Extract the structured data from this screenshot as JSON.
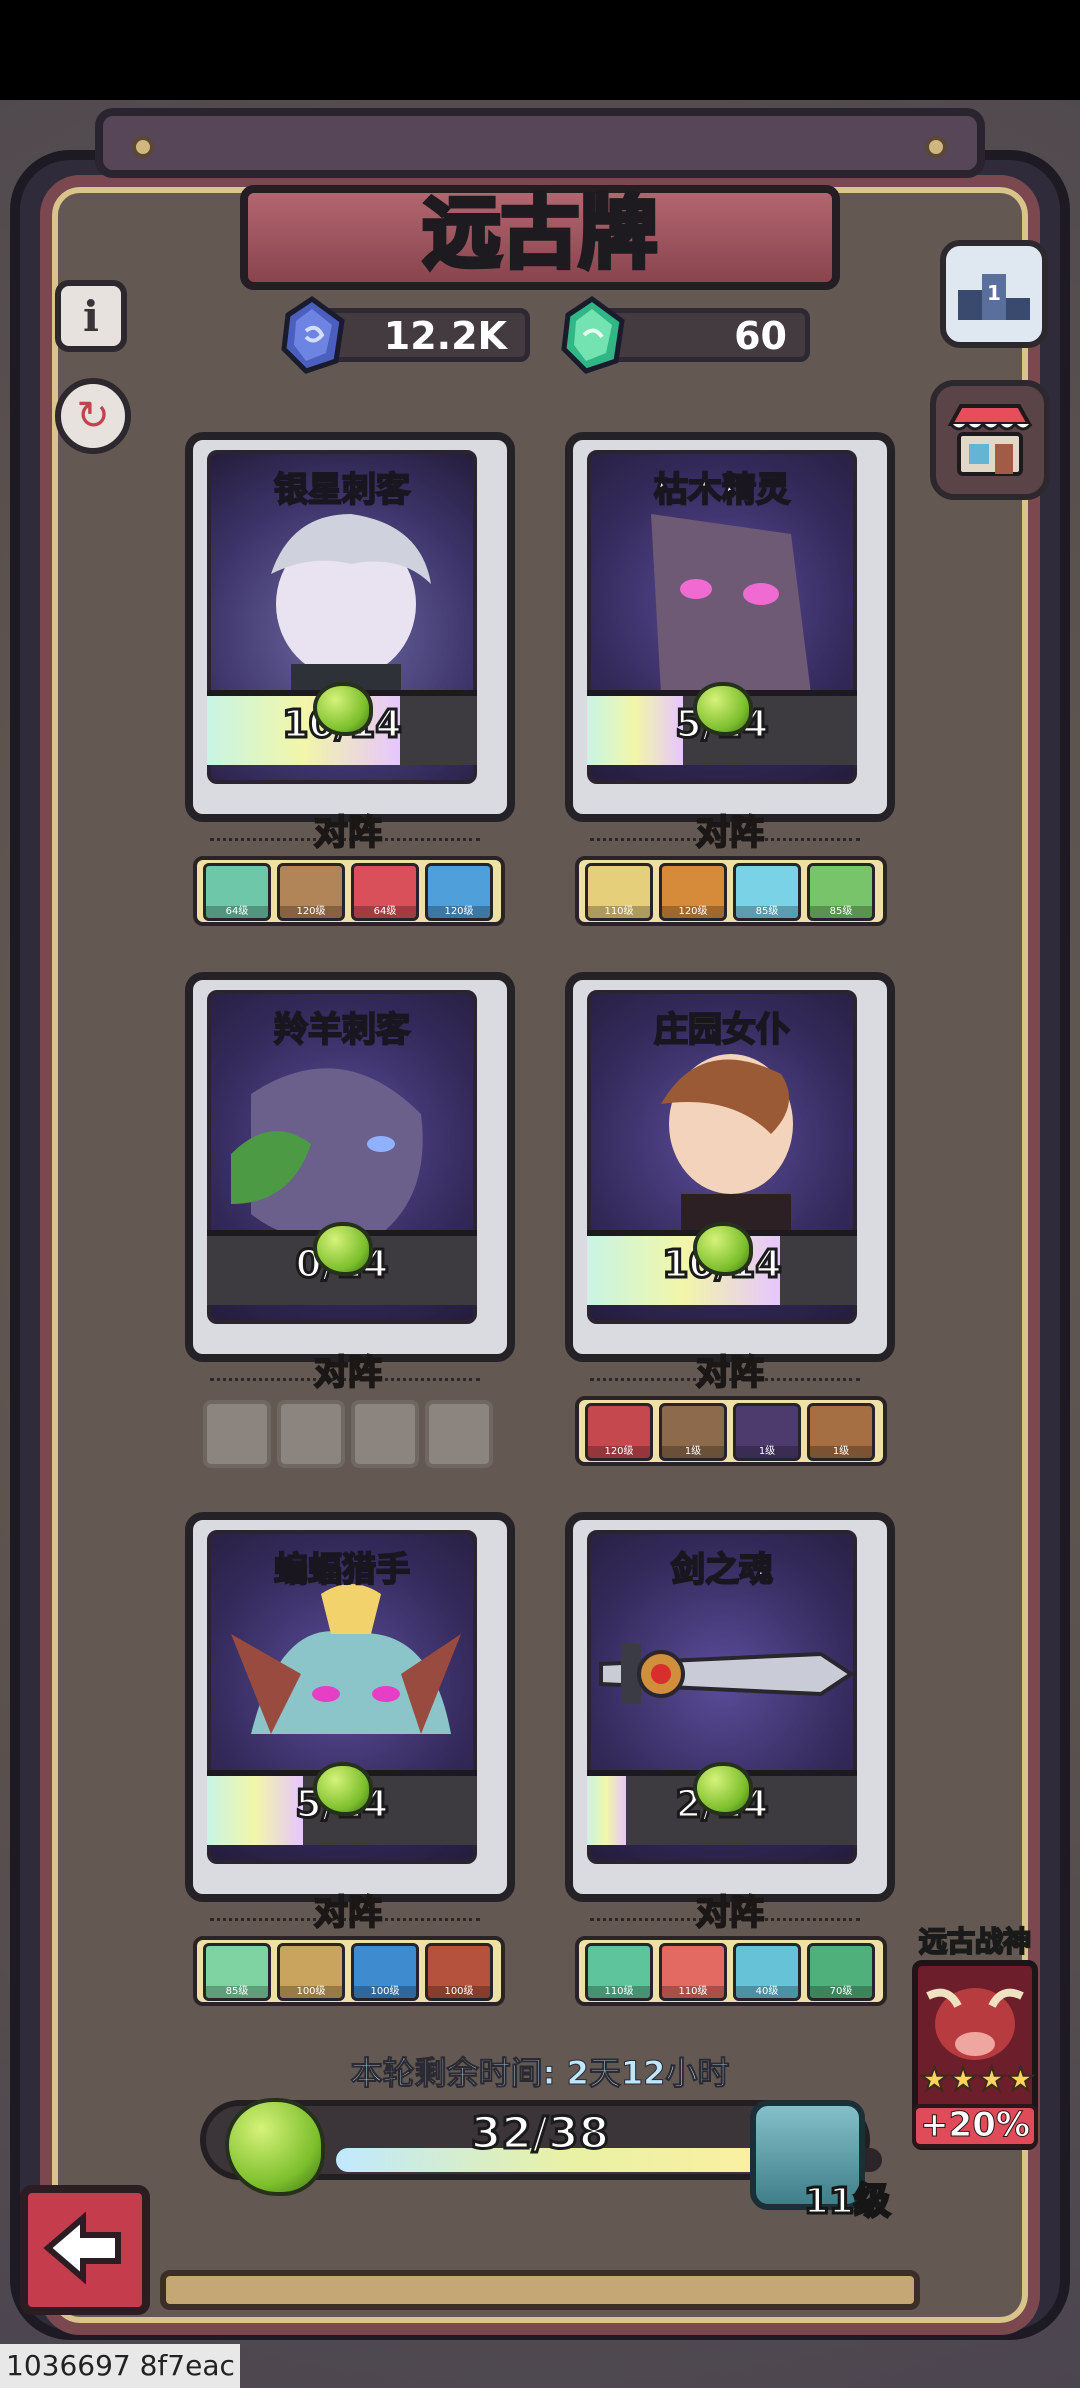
{
  "header": {
    "title": "远古牌",
    "currency_blue": "12.2K",
    "currency_green": "60"
  },
  "side_buttons": {
    "left_top": "info-icon",
    "left_second": "refresh-icon",
    "right_top": "ranking-icon",
    "right_second": "shop-icon"
  },
  "cards": [
    {
      "name": "银星刺客",
      "progress": "10/14",
      "fraction": 0.714,
      "team_label": "对阵",
      "team": [
        "64级",
        "120级",
        "64级",
        "120级"
      ]
    },
    {
      "name": "枯木精灵",
      "progress": "5/14",
      "fraction": 0.357,
      "team_label": "对阵",
      "team": [
        "110级",
        "120级",
        "85级",
        "85级"
      ]
    },
    {
      "name": "羚羊刺客",
      "progress": "0/14",
      "fraction": 0.0,
      "team_label": "对阵",
      "team": []
    },
    {
      "name": "庄园女仆",
      "progress": "10/14",
      "fraction": 0.714,
      "team_label": "对阵",
      "team": [
        "120级",
        "1级",
        "1级",
        "1级"
      ]
    },
    {
      "name": "蝙蝠猎手",
      "progress": "5/14",
      "fraction": 0.357,
      "team_label": "对阵",
      "team": [
        "85级",
        "100级",
        "100级",
        "100级"
      ]
    },
    {
      "name": "剑之魂",
      "progress": "2/14",
      "fraction": 0.143,
      "team_label": "对阵",
      "team": [
        "110级",
        "110级",
        "40级",
        "70级"
      ]
    }
  ],
  "footer": {
    "timer": "本轮剩余时间: 2天12小时",
    "progress_text": "32/38",
    "progress_fraction": 0.842,
    "level": "11级",
    "reward_title": "远古战神",
    "reward_stars": "★★★★",
    "reward_bonus": "+20%"
  },
  "watermark": "1036697 8f7eac"
}
